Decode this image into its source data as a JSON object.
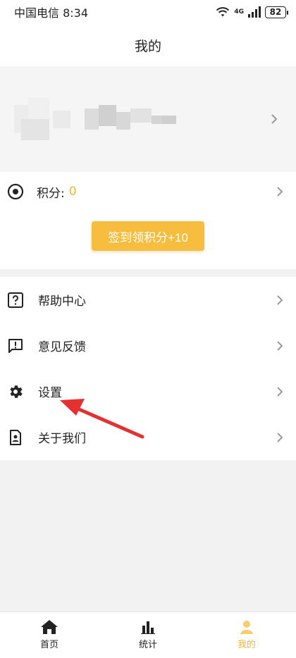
{
  "status_bar": {
    "carrier_time": "中国电信 8:34",
    "network": "4G",
    "battery": "82"
  },
  "header": {
    "title": "我的"
  },
  "points": {
    "label": "积分:",
    "value": "0",
    "signin_button": "签到领积分+10"
  },
  "menu": {
    "items": [
      {
        "label": "帮助中心",
        "icon": "help-icon"
      },
      {
        "label": "意见反馈",
        "icon": "feedback-icon"
      },
      {
        "label": "设置",
        "icon": "gear-icon"
      },
      {
        "label": "关于我们",
        "icon": "about-icon"
      }
    ]
  },
  "tabbar": {
    "items": [
      {
        "label": "首页",
        "icon": "home-icon"
      },
      {
        "label": "统计",
        "icon": "stats-icon"
      },
      {
        "label": "我的",
        "icon": "profile-icon"
      }
    ]
  },
  "colors": {
    "accent": "#f7bd3e",
    "accent_text": "#f5b830",
    "annotation_arrow": "#e53030"
  }
}
